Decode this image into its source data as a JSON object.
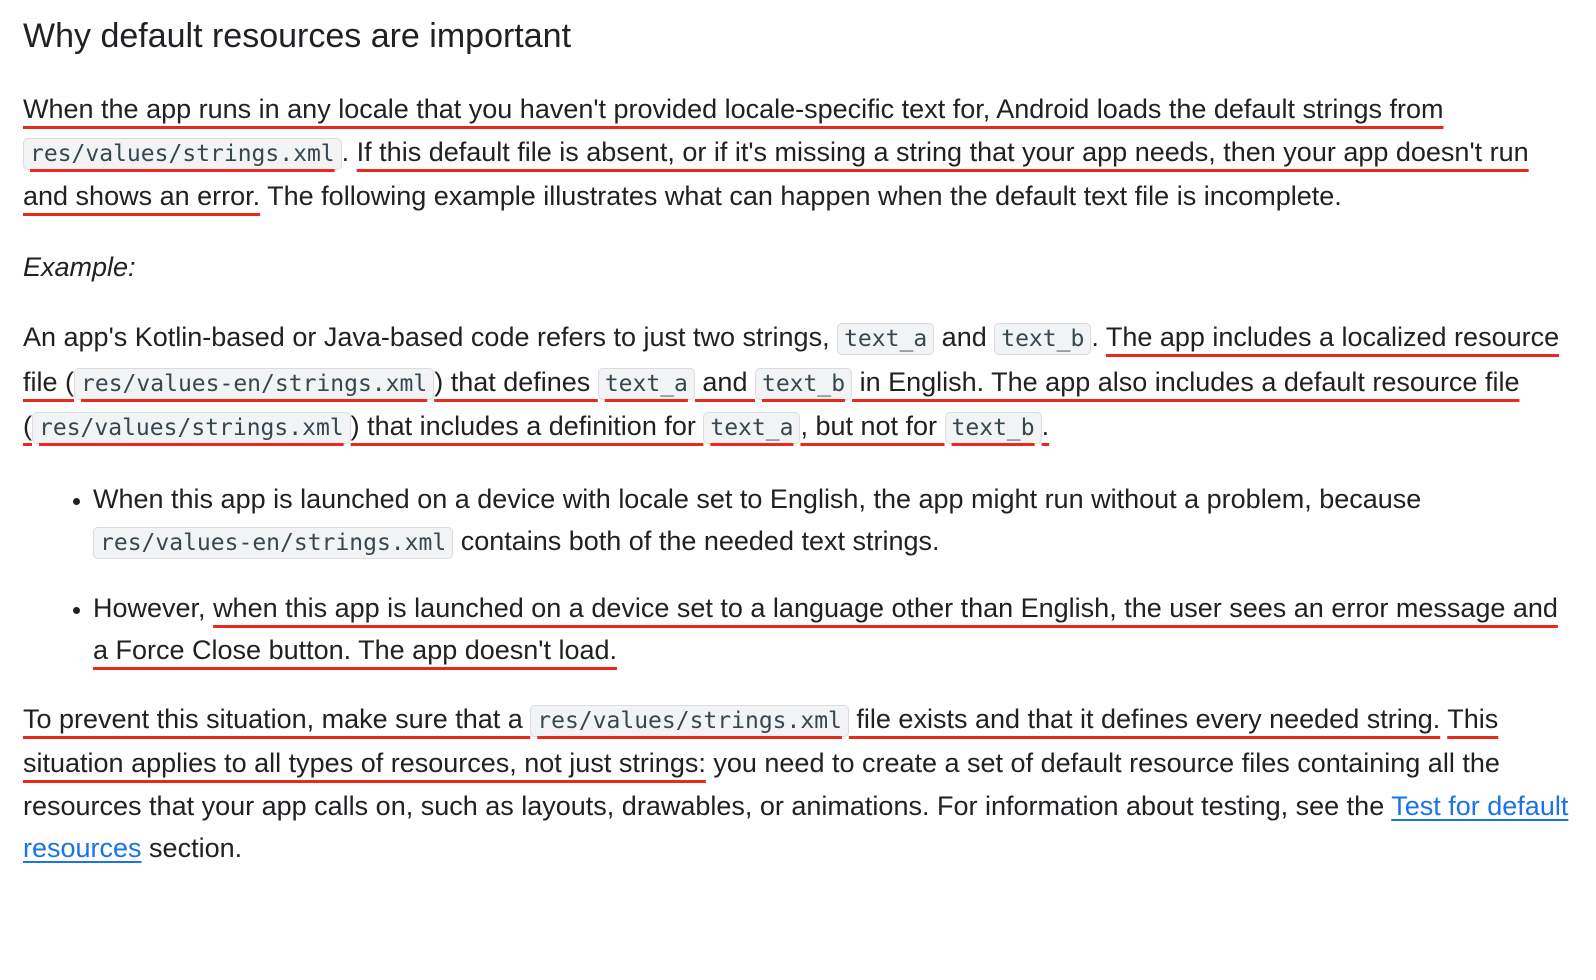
{
  "heading": "Why default resources are important",
  "p1": {
    "s1": "When the app runs in any locale that you haven't provided locale-specific text for, Android loads the default strings from",
    "code1": "res/values/strings.xml",
    "s2": ".",
    "s3": "If this default file is absent, or if it's missing a string that your app needs, then your app doesn't run and shows an error.",
    "s4": " The following example illustrates what can happen when the default text file is incomplete."
  },
  "example_label": "Example:",
  "p2": {
    "s1": "An app's Kotlin-based or Java-based code refers to just two strings, ",
    "code_a1": "text_a",
    "s2": " and ",
    "code_b1": "text_b",
    "s3": ". ",
    "u1": "The app includes a localized resource file (",
    "code_en": "res/values-en/strings.xml",
    "u2": ") that defines ",
    "code_a2": "text_a",
    "u3": " and ",
    "code_b2": "text_b",
    "u4": " in English. The app also includes a default resource file (",
    "code_def": "res/values/strings.xml",
    "u5": ") that includes a definition for ",
    "code_a3": "text_a",
    "u6": ", but not for ",
    "code_b3": "text_b",
    "u7": "."
  },
  "bullets": {
    "b1_text1": "When this app is launched on a device with locale set to English, the app might run without a problem, because ",
    "b1_code": "res/values-en/strings.xml",
    "b1_text2": " contains both of the needed text strings.",
    "b2_prefix": "However, ",
    "b2_underlined": "when this app is launched on a device set to a language other than English, the user sees an error message and a Force Close button. The app doesn't load."
  },
  "p3": {
    "u1": "To prevent this situation, make sure that a ",
    "code1": "res/values/strings.xml",
    "u2": " file exists and that it defines every needed string.",
    "s_space": " ",
    "u3": "This situation applies to all types of resources, not just strings:",
    "s1": " you need to create a set of default resource files containing all the resources that your app calls on, such as layouts, drawables, or animations. For information about testing, see the ",
    "link": "Test for default resources",
    "s2": " section."
  },
  "colors": {
    "text": "#202124",
    "underline_annotation": "#e8291c",
    "link": "#1a73e8",
    "code_bg": "#f1f3f4"
  }
}
